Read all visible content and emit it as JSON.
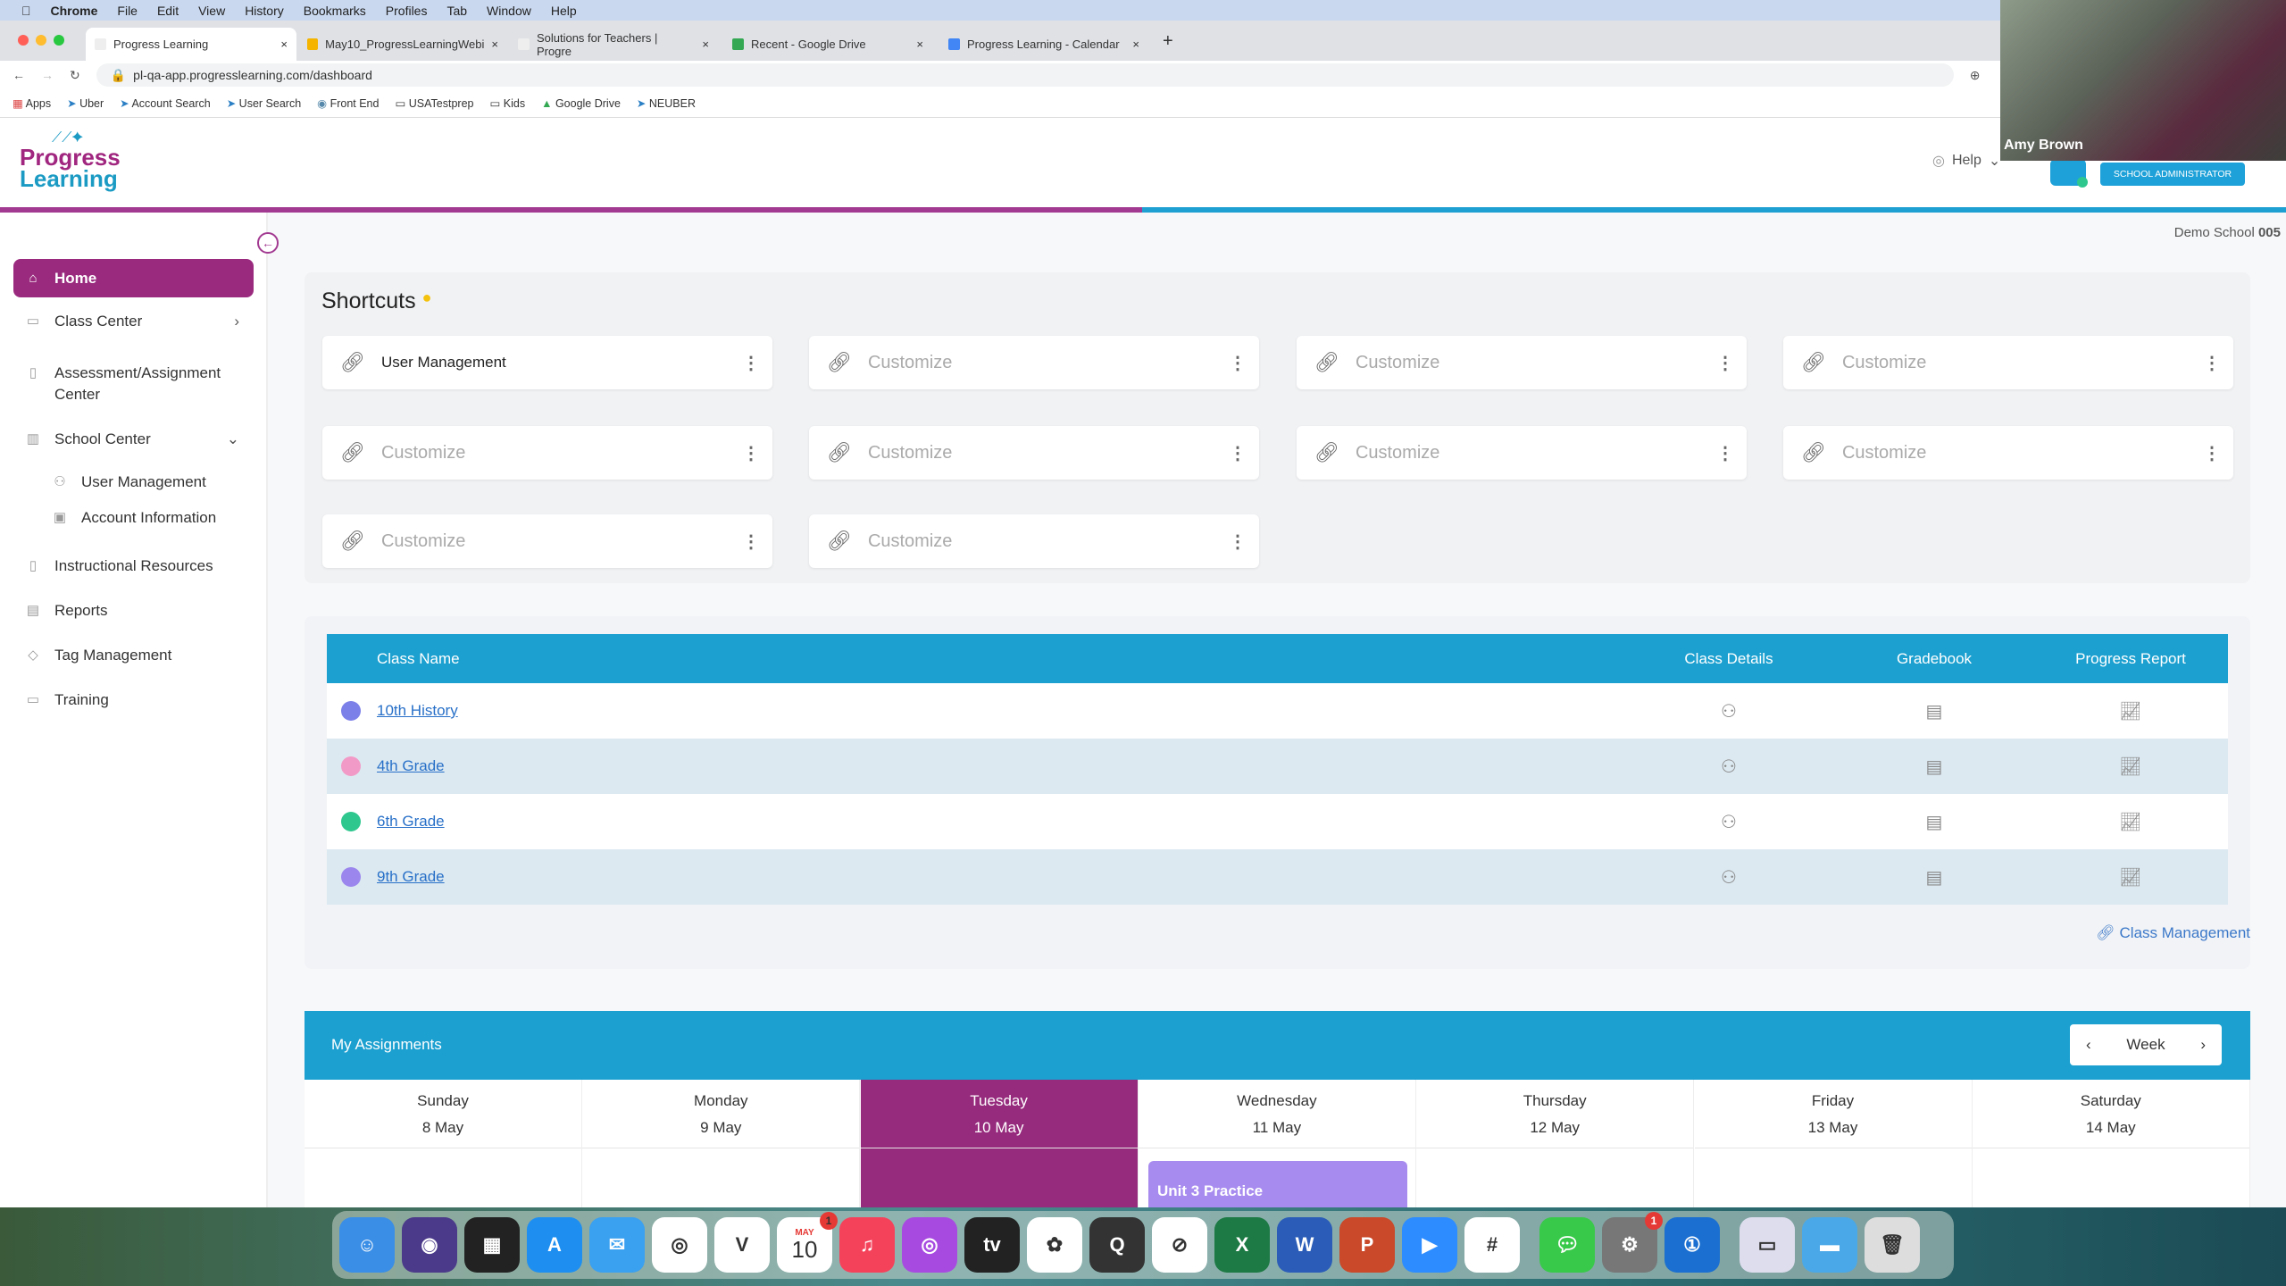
{
  "menubar": {
    "apple": "",
    "items": [
      "Chrome",
      "File",
      "Edit",
      "View",
      "History",
      "Bookmarks",
      "Profiles",
      "Tab",
      "Window",
      "Help"
    ]
  },
  "tabs": [
    {
      "title": "Progress Learning",
      "active": true,
      "color": "#9a2a7e"
    },
    {
      "title": "May10_ProgressLearningWebi",
      "color": "#f4b400"
    },
    {
      "title": "Solutions for Teachers | Progre",
      "color": "#9a2a7e"
    },
    {
      "title": "Recent - Google Drive",
      "color": "#34a853"
    },
    {
      "title": "Progress Learning - Calendar",
      "color": "#4285f4"
    }
  ],
  "address": {
    "url": "pl-qa-app.progresslearning.com/dashboard"
  },
  "bookmarks": [
    "Apps",
    "Uber",
    "Account Search",
    "User Search",
    "Front End",
    "USATestprep",
    "Kids",
    "Google Drive",
    "NEUBER"
  ],
  "header": {
    "logo_top": "Progress",
    "logo_bottom": "Learning",
    "help": "Help",
    "role": "SCHOOL ADMINISTRATOR",
    "school_name": "Demo School",
    "school_num": "005"
  },
  "webcam": {
    "name": "Amy Brown"
  },
  "sidebar": {
    "items": [
      {
        "label": "Home",
        "icon": "home-icon",
        "active": true
      },
      {
        "label": "Class Center",
        "icon": "classroom-icon"
      },
      {
        "label": "Assessment/Assignment Center",
        "icon": "book-icon"
      },
      {
        "label": "School Center",
        "icon": "school-icon"
      },
      {
        "label": "User Management",
        "icon": "users-icon"
      },
      {
        "label": "Account Information",
        "icon": "account-icon"
      },
      {
        "label": "Instructional Resources",
        "icon": "resources-icon"
      },
      {
        "label": "Reports",
        "icon": "report-icon"
      },
      {
        "label": "Tag Management",
        "icon": "tag-icon"
      },
      {
        "label": "Training",
        "icon": "training-icon"
      }
    ]
  },
  "shortcuts": {
    "title": "Shortcuts",
    "items": [
      "User Management",
      "Customize",
      "Customize",
      "Customize",
      "Customize",
      "Customize",
      "Customize",
      "Customize",
      "Customize",
      "Customize"
    ]
  },
  "classes": {
    "headers": {
      "name": "Class Name",
      "details": "Class Details",
      "gradebook": "Gradebook",
      "progress": "Progress Report"
    },
    "rows": [
      {
        "name": "10th History",
        "color": "#7b7fe8"
      },
      {
        "name": "4th Grade",
        "color": "#f29ac7"
      },
      {
        "name": "6th Grade",
        "color": "#2ec78e"
      },
      {
        "name": "9th Grade",
        "color": "#9b86ee"
      }
    ],
    "manage_link": "Class Management"
  },
  "assignments": {
    "title": "My Assignments",
    "view": "Week",
    "days": [
      {
        "name": "Sunday",
        "date": "8 May"
      },
      {
        "name": "Monday",
        "date": "9 May"
      },
      {
        "name": "Tuesday",
        "date": "10 May",
        "today": true
      },
      {
        "name": "Wednesday",
        "date": "11 May"
      },
      {
        "name": "Thursday",
        "date": "12 May"
      },
      {
        "name": "Friday",
        "date": "13 May"
      },
      {
        "name": "Saturday",
        "date": "14 May"
      }
    ],
    "event": "Unit 3 Practice"
  },
  "dock": {
    "apps": [
      "Finder",
      "Siri",
      "Mission Control",
      "App Store",
      "Mail",
      "Chrome",
      "Vectorworks",
      "Calendar",
      "Music",
      "Podcasts",
      "TV",
      "Photos",
      "QuickTime",
      "Safari",
      "Excel",
      "Word",
      "PowerPoint",
      "Zoom",
      "Slack",
      "Messages",
      "System Preferences",
      "1Password",
      "Preview",
      "Folder",
      "Trash"
    ],
    "calendar_day": "10",
    "calendar_month": "MAY"
  }
}
